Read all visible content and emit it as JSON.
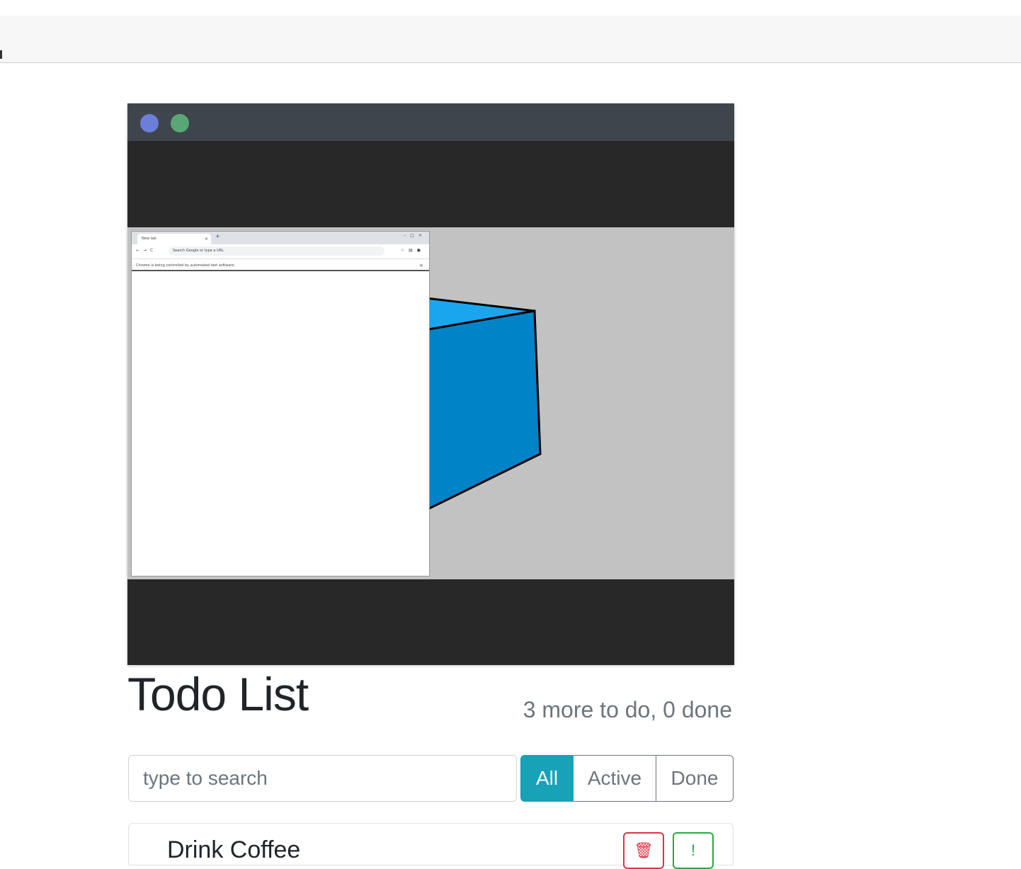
{
  "colors": {
    "titlebar": "#3e454d",
    "dot_blue": "#6c7fd8",
    "dot_green": "#58a774",
    "scene_bg": "#c2c2c2",
    "cube_top": "#1aa6ef",
    "cube_side": "#0083c7",
    "filter_active": "#17a2b8"
  },
  "mini_browser": {
    "tab_title": "New tab",
    "url_text": "Search Google or type a URL",
    "infobar_text": "Chrome is being controlled by automated test software."
  },
  "todo": {
    "title": "Todo List",
    "status": "3 more to do, 0 done",
    "search_placeholder": "type to search",
    "filters": {
      "all": "All",
      "active": "Active",
      "done": "Done"
    },
    "items": [
      {
        "label": "Drink Coffee",
        "delete_icon": "trash-icon",
        "important_icon": "exclamation-icon"
      }
    ]
  }
}
